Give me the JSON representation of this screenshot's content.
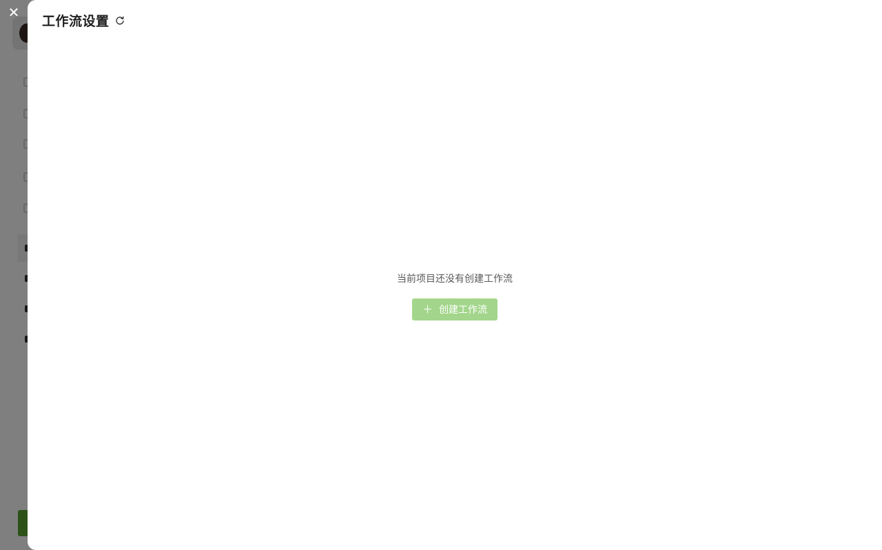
{
  "drawer": {
    "title": "工作流设置",
    "close_icon": "close-icon",
    "refresh_icon": "refresh-icon"
  },
  "empty_state": {
    "message": "当前项目还没有创建工作流",
    "create_button": {
      "label": "创建工作流",
      "icon": "plus-icon"
    }
  },
  "colors": {
    "overlay": "#7d7d7d",
    "button_bg": "#a3d68c",
    "title": "#1f1f1f",
    "message": "#595959"
  }
}
